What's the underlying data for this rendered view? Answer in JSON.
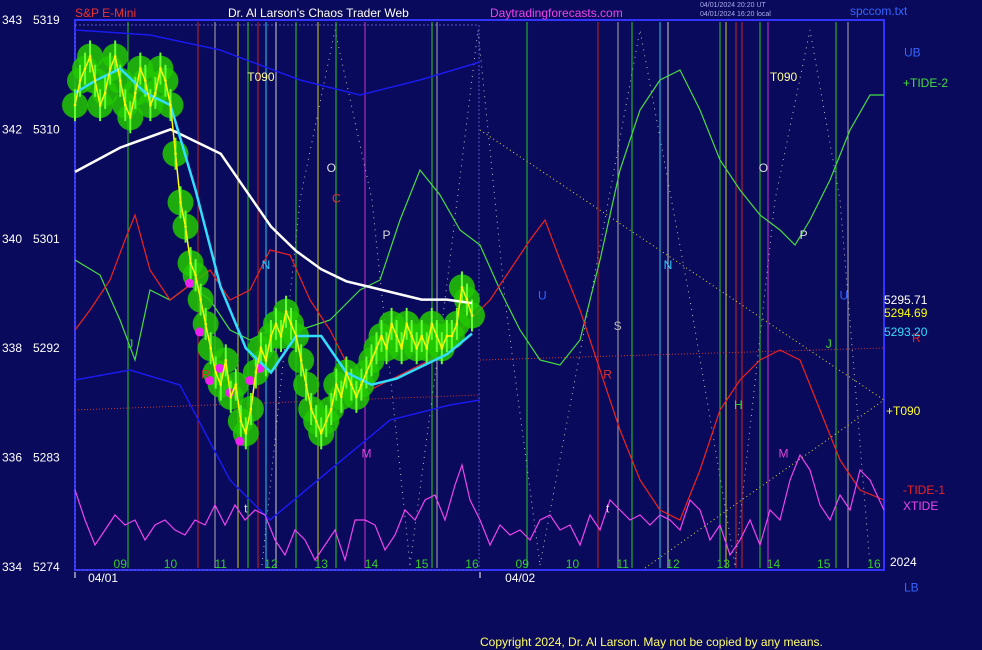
{
  "header": {
    "symbol": "S&P E-Mini",
    "title": "Dr. Al Larson's Chaos Trader Web",
    "site": "Daytradingforecasts.com",
    "stamp1": "04/01/2024 20:20 UT",
    "stamp2": "04/01/2024 16:20 local",
    "file": "spccom.txt"
  },
  "footer": {
    "copyright": "Copyright 2024, Dr. Al Larson. May not be copied by any means."
  },
  "colors": {
    "background": "#0a0a5c",
    "plot_border": "#3333ff",
    "price": "#ffff00",
    "band": "#22c800",
    "fast_avg": "#33ddff",
    "slow_avg": "#ffffff",
    "tide_plus2": "#44dd44",
    "tide_minus1": "#ee2222",
    "xtide": "#ee44ee",
    "ub_lb": "#1a1aee",
    "magenta_dots": "#ee22ee"
  },
  "chart_data": {
    "type": "line",
    "y_ticks_left": [
      {
        "index": "343",
        "price": "5319",
        "value": 5319
      },
      {
        "index": "342",
        "price": "5310",
        "value": 5310
      },
      {
        "index": "340",
        "price": "5301",
        "value": 5301
      },
      {
        "index": "338",
        "price": "5292",
        "value": 5292
      },
      {
        "index": "336",
        "price": "5283",
        "value": 5283
      },
      {
        "index": "334",
        "price": "5274",
        "value": 5274
      }
    ],
    "ylim": [
      5274,
      5319
    ],
    "x_ticks": [
      {
        "label": "09",
        "x": 9
      },
      {
        "label": "10",
        "x": 10
      },
      {
        "label": "11",
        "x": 11
      },
      {
        "label": "12",
        "x": 12
      },
      {
        "label": "13",
        "x": 13
      },
      {
        "label": "14",
        "x": 14
      },
      {
        "label": "15",
        "x": 15
      },
      {
        "label": "16",
        "x": 16
      },
      {
        "label": "09",
        "x": 17
      },
      {
        "label": "10",
        "x": 18
      },
      {
        "label": "11",
        "x": 19
      },
      {
        "label": "12",
        "x": 20
      },
      {
        "label": "13",
        "x": 21
      },
      {
        "label": "14",
        "x": 22
      },
      {
        "label": "15",
        "x": 23
      },
      {
        "label": "16",
        "x": 24
      }
    ],
    "xlim": [
      8.1,
      24.2
    ],
    "dates": [
      {
        "label": "04/01",
        "x": 8.5
      },
      {
        "label": "04/02",
        "x": 16.8
      }
    ],
    "year_label": "2024",
    "right_values": [
      {
        "label": "5295.71",
        "value": 5295.71,
        "color": "#ffffff"
      },
      {
        "label": "5294.69",
        "value": 5294.69,
        "color": "#ffff00"
      },
      {
        "label": "5293.20",
        "value": 5293.2,
        "color": "#33ddff"
      }
    ],
    "series": [
      {
        "name": "price",
        "x": [
          8.1,
          8.2,
          8.3,
          8.4,
          8.5,
          8.6,
          8.7,
          8.8,
          8.9,
          9.0,
          9.1,
          9.2,
          9.3,
          9.4,
          9.5,
          9.6,
          9.7,
          9.8,
          9.9,
          10.0,
          10.1,
          10.2,
          10.3,
          10.4,
          10.5,
          10.6,
          10.7,
          10.8,
          10.9,
          11.0,
          11.1,
          11.2,
          11.3,
          11.4,
          11.5,
          11.6,
          11.7,
          11.8,
          11.9,
          12.0,
          12.1,
          12.2,
          12.3,
          12.4,
          12.5,
          12.6,
          12.7,
          12.8,
          12.9,
          13.0,
          13.1,
          13.2,
          13.3,
          13.4,
          13.5,
          13.6,
          13.7,
          13.8,
          13.9,
          14.0,
          14.1,
          14.2,
          14.3,
          14.4,
          14.5,
          14.6,
          14.7,
          14.8,
          14.9,
          15.0,
          15.1,
          15.2,
          15.3,
          15.4,
          15.5,
          15.6,
          15.7,
          15.8,
          15.9,
          16.0
        ],
        "values": [
          5312,
          5314,
          5315,
          5316,
          5314,
          5312,
          5313,
          5315,
          5316,
          5314,
          5312,
          5311,
          5313,
          5315,
          5314,
          5312,
          5313,
          5315,
          5314,
          5312,
          5308,
          5304,
          5302,
          5299,
          5298,
          5296,
          5294,
          5292,
          5290,
          5289,
          5291,
          5288,
          5289,
          5286,
          5285,
          5287,
          5290,
          5292,
          5291,
          5293,
          5294,
          5293,
          5295,
          5294,
          5293,
          5291,
          5289,
          5287,
          5286,
          5285,
          5286,
          5287,
          5289,
          5288,
          5290,
          5289,
          5288,
          5289,
          5290,
          5291,
          5292,
          5293,
          5292,
          5294,
          5293,
          5292,
          5294,
          5293,
          5292,
          5293,
          5292,
          5294,
          5293,
          5292,
          5293,
          5293,
          5294,
          5297,
          5296,
          5294.69
        ]
      },
      {
        "name": "fast average",
        "x": [
          8.1,
          8.5,
          9.0,
          9.5,
          10.0,
          10.5,
          11.0,
          11.5,
          12.0,
          12.5,
          13.0,
          13.5,
          14.0,
          14.5,
          15.0,
          15.5,
          16.0
        ],
        "values": [
          5313,
          5314,
          5315,
          5313,
          5312,
          5305,
          5297,
          5292,
          5290,
          5293,
          5293,
          5290,
          5289,
          5289.5,
          5290.5,
          5291.5,
          5293.2
        ]
      },
      {
        "name": "slow average",
        "x": [
          8.1,
          9.0,
          10.0,
          11.0,
          11.5,
          12.0,
          12.5,
          13.0,
          13.5,
          14.0,
          14.5,
          15.0,
          15.5,
          16.0
        ],
        "values": [
          5306.5,
          5308.5,
          5310,
          5308,
          5305,
          5302,
          5300,
          5298.5,
          5297.5,
          5297,
          5296.5,
          5296,
          5296,
          5295.71
        ]
      }
    ],
    "band_center": "price",
    "annotations": [
      {
        "text": "T090",
        "x": 11.8,
        "value": 5314,
        "color": "#ffff99"
      },
      {
        "text": "T090",
        "x": 22.2,
        "value": 5314,
        "color": "#ffff99"
      },
      {
        "text": "O",
        "x": 13.2,
        "value": 5306.5,
        "color": "#dddddd"
      },
      {
        "text": "O",
        "x": 21.8,
        "value": 5306.5,
        "color": "#dddddd"
      },
      {
        "text": "C",
        "x": 13.3,
        "value": 5304,
        "color": "#dd3333"
      },
      {
        "text": "P",
        "x": 14.3,
        "value": 5301,
        "color": "#dddddd"
      },
      {
        "text": "P",
        "x": 22.6,
        "value": 5301,
        "color": "#dddddd"
      },
      {
        "text": "N",
        "x": 11.9,
        "value": 5298.5,
        "color": "#33ccff"
      },
      {
        "text": "N",
        "x": 19.9,
        "value": 5298.5,
        "color": "#33ccff"
      },
      {
        "text": "U",
        "x": 17.4,
        "value": 5296,
        "color": "#3366ff"
      },
      {
        "text": "U",
        "x": 23.4,
        "value": 5296,
        "color": "#3366ff"
      },
      {
        "text": "S",
        "x": 18.9,
        "value": 5293.5,
        "color": "#bbbbbb"
      },
      {
        "text": "J",
        "x": 9.2,
        "value": 5292,
        "color": "#33dd33"
      },
      {
        "text": "J",
        "x": 23.1,
        "value": 5292,
        "color": "#33dd33"
      },
      {
        "text": "R",
        "x": 10.7,
        "value": 5289.5,
        "color": "#dd3333"
      },
      {
        "text": "R",
        "x": 18.7,
        "value": 5289.5,
        "color": "#dd3333"
      },
      {
        "text": "H",
        "x": 21.3,
        "value": 5287,
        "color": "#33dd33"
      },
      {
        "text": "M",
        "x": 13.9,
        "value": 5283,
        "color": "#dd44dd"
      },
      {
        "text": "M",
        "x": 22.2,
        "value": 5283,
        "color": "#dd44dd"
      },
      {
        "text": "t",
        "x": 11.5,
        "value": 5278.5,
        "color": "#dddddd"
      },
      {
        "text": "t",
        "x": 18.7,
        "value": 5278.5,
        "color": "#dddddd"
      }
    ],
    "right_legend": [
      {
        "text": "UB",
        "value": 5316,
        "color": "#3366ff"
      },
      {
        "text": "+TIDE-2",
        "value": 5313.5,
        "color": "#44dd44"
      },
      {
        "text": "R",
        "value": 5292.5,
        "color": "#ee2222"
      },
      {
        "text": "+T090",
        "value": 5286.5,
        "color": "#ffff33"
      },
      {
        "text": "-TIDE-1",
        "value": 5280,
        "color": "#ee2222"
      },
      {
        "text": "XTIDE",
        "value": 5278.7,
        "color": "#ee44ee"
      },
      {
        "text": "LB",
        "value": 5272,
        "color": "#3366ff"
      }
    ],
    "grid": false,
    "legend": "right"
  }
}
